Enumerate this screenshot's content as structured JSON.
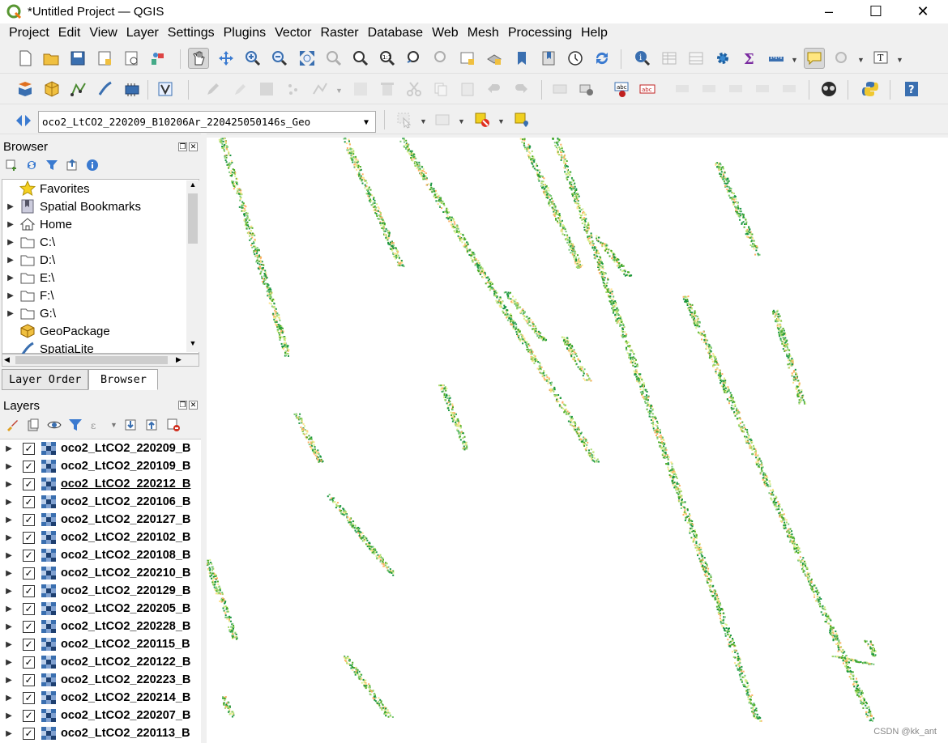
{
  "window": {
    "title": "*Untitled Project — QGIS",
    "controls": [
      "–",
      "☐",
      "✕"
    ]
  },
  "menu": [
    "Project",
    "Edit",
    "View",
    "Layer",
    "Settings",
    "Plugins",
    "Vector",
    "Raster",
    "Database",
    "Web",
    "Mesh",
    "Processing",
    "Help"
  ],
  "layer_combo": {
    "value": "oco2_LtCO2_220209_B10206Ar_220425050146s_Geo"
  },
  "browser": {
    "title": "Browser",
    "items": [
      {
        "label": "Favorites",
        "icon": "star-icon",
        "expandable": false
      },
      {
        "label": "Spatial Bookmarks",
        "icon": "bookmark-icon",
        "expandable": true
      },
      {
        "label": "Home",
        "icon": "home-icon",
        "expandable": true
      },
      {
        "label": "C:\\",
        "icon": "folder-icon",
        "expandable": true
      },
      {
        "label": "D:\\",
        "icon": "folder-icon",
        "expandable": true
      },
      {
        "label": "E:\\",
        "icon": "folder-icon",
        "expandable": true
      },
      {
        "label": "F:\\",
        "icon": "folder-icon",
        "expandable": true
      },
      {
        "label": "G:\\",
        "icon": "folder-icon",
        "expandable": true
      },
      {
        "label": "GeoPackage",
        "icon": "geopackage-icon",
        "expandable": false
      },
      {
        "label": "SpatiaLite",
        "icon": "spatialite-icon",
        "expandable": false
      }
    ]
  },
  "bottom_tabs": [
    "Layer Order",
    "Browser"
  ],
  "layers": {
    "title": "Layers",
    "items": [
      "oco2_LtCO2_220209_B",
      "oco2_LtCO2_220109_B",
      "oco2_LtCO2_220212_B",
      "oco2_LtCO2_220106_B",
      "oco2_LtCO2_220127_B",
      "oco2_LtCO2_220102_B",
      "oco2_LtCO2_220108_B",
      "oco2_LtCO2_220210_B",
      "oco2_LtCO2_220129_B",
      "oco2_LtCO2_220205_B",
      "oco2_LtCO2_220228_B",
      "oco2_LtCO2_220115_B",
      "oco2_LtCO2_220122_B",
      "oco2_LtCO2_220223_B",
      "oco2_LtCO2_220214_B",
      "oco2_LtCO2_220207_B",
      "oco2_LtCO2_220113_B"
    ],
    "check_mark": "✓"
  },
  "map": {
    "watermark": "CSDN @kk_ant",
    "palette": [
      "#1a9641",
      "#4dac26",
      "#78c679",
      "#a6d96a",
      "#d9ef8b",
      "#fee08b",
      "#fdae61"
    ]
  }
}
